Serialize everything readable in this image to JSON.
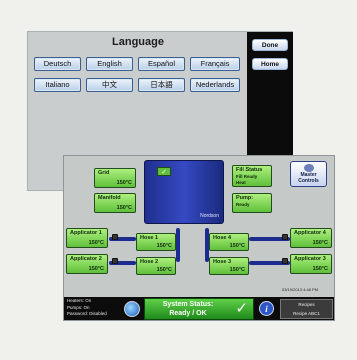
{
  "language_screen": {
    "title": "Language",
    "languages": [
      "Deutsch",
      "English",
      "Español",
      "Français",
      "Italiano",
      "中文",
      "日本語",
      "Nederlands"
    ],
    "side_buttons": [
      "Done",
      "Home"
    ]
  },
  "melter_screen": {
    "zones": {
      "grid": {
        "label": "Grid",
        "temp": "150°C"
      },
      "manifold": {
        "label": "Manifold",
        "temp": "150°C"
      },
      "applicator1": {
        "label": "Applicator 1",
        "temp": "150°C"
      },
      "applicator2": {
        "label": "Applicator 2",
        "temp": "150°C"
      },
      "applicator3": {
        "label": "Applicator 3",
        "temp": "150°C"
      },
      "applicator4": {
        "label": "Applicator 4",
        "temp": "150°C"
      },
      "hose1": {
        "label": "Hose 1",
        "temp": "150°C"
      },
      "hose2": {
        "label": "Hose 2",
        "temp": "150°C"
      },
      "hose3": {
        "label": "Hose 3",
        "temp": "150°C"
      },
      "hose4": {
        "label": "Hose 4",
        "temp": "150°C"
      }
    },
    "fill_status": {
      "title": "Fill Status",
      "line1": "Fill Ready",
      "line2": "Heat"
    },
    "pump": {
      "title": "Pump:",
      "status": "Ready"
    },
    "master_controls": "Master Controls",
    "unit_brand": "Nordson",
    "unit_check": "✓",
    "timestamp": "03/19/2013 4:46 PM",
    "status_bar": {
      "heaters": "Heaters: On",
      "pumps": "Pumps: On",
      "password": "Password: Disabled",
      "status_title": "System Status:",
      "status_value": "Ready / OK",
      "status_check": "✓",
      "info_label": "i",
      "recipes_label": "Recipes",
      "recipe_name": "Recipe ABC1"
    }
  },
  "colors": {
    "zone_green": "#7ed957",
    "hose_blue": "#1b2b8f",
    "status_green": "#3fae2f",
    "panel_gray": "#c5c9c8"
  }
}
